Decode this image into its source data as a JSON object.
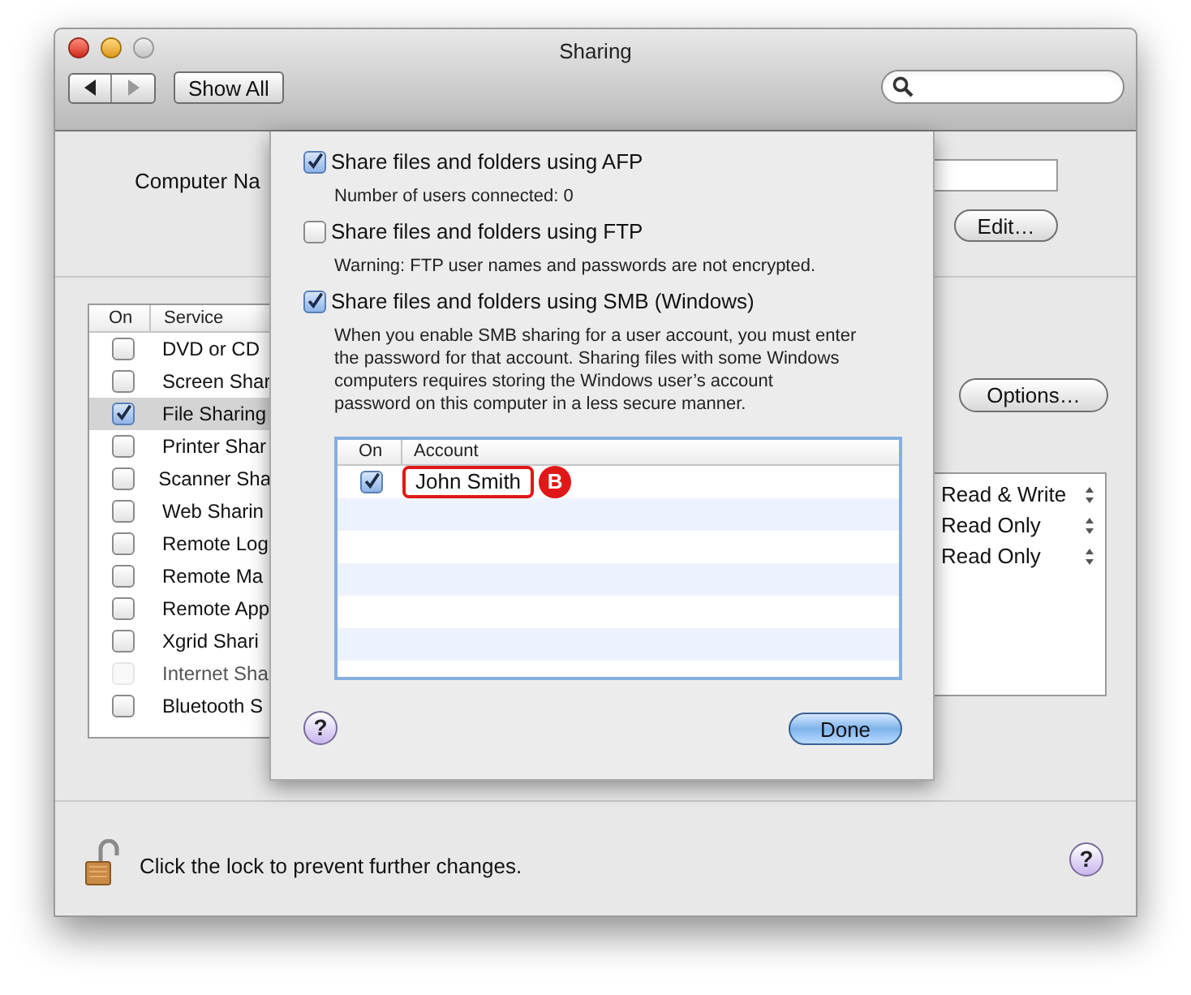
{
  "window": {
    "title": "Sharing"
  },
  "toolbar": {
    "show_all": "Show All"
  },
  "computer_name": {
    "label": "Computer Na"
  },
  "edit_button": "Edit…",
  "services": {
    "columns": [
      "On",
      "Service"
    ],
    "rows": [
      {
        "checked": false,
        "selected": false,
        "disabled": false,
        "name": "DVD or CD"
      },
      {
        "checked": false,
        "selected": false,
        "disabled": false,
        "name": "Screen Shar"
      },
      {
        "checked": true,
        "selected": true,
        "disabled": false,
        "name": "File Sharing"
      },
      {
        "checked": false,
        "selected": false,
        "disabled": false,
        "name": "Printer Shar"
      },
      {
        "checked": false,
        "selected": false,
        "disabled": false,
        "name": "Scanner Sha"
      },
      {
        "checked": false,
        "selected": false,
        "disabled": false,
        "name": "Web Sharin"
      },
      {
        "checked": false,
        "selected": false,
        "disabled": false,
        "name": "Remote Log"
      },
      {
        "checked": false,
        "selected": false,
        "disabled": false,
        "name": "Remote Ma"
      },
      {
        "checked": false,
        "selected": false,
        "disabled": false,
        "name": "Remote App"
      },
      {
        "checked": false,
        "selected": false,
        "disabled": false,
        "name": "Xgrid Shari"
      },
      {
        "checked": false,
        "selected": false,
        "disabled": true,
        "name": "Internet Sha"
      },
      {
        "checked": false,
        "selected": false,
        "disabled": false,
        "name": "Bluetooth S"
      }
    ]
  },
  "options_button": "Options…",
  "permissions": [
    {
      "value": "Read & Write"
    },
    {
      "value": "Read Only"
    },
    {
      "value": "Read Only"
    }
  ],
  "lock_text": "Click the lock to prevent further changes.",
  "help": "?",
  "sheet": {
    "items": [
      {
        "kind": "checkbox",
        "label": "Share files and folders using AFP",
        "checked": true
      },
      {
        "kind": "note",
        "text": "Number of users connected: 0"
      },
      {
        "kind": "checkbox",
        "label": "Share files and folders using FTP",
        "checked": false
      },
      {
        "kind": "note",
        "text": "Warning: FTP user names and passwords are not encrypted."
      },
      {
        "kind": "checkbox",
        "label": "Share files and folders using SMB (Windows)",
        "checked": true
      },
      {
        "kind": "paragraph",
        "text": "When you enable SMB sharing for a user account, you must enter\nthe password for that account. Sharing files with some Windows\ncomputers requires storing the Windows user’s account\npassword on this computer in a less secure manner."
      }
    ],
    "accounts": {
      "columns": [
        "On",
        "Account"
      ],
      "rows": [
        {
          "checked": true,
          "name": "John Smith",
          "callout": "B"
        }
      ]
    },
    "help": "?",
    "done_button": "Done"
  }
}
